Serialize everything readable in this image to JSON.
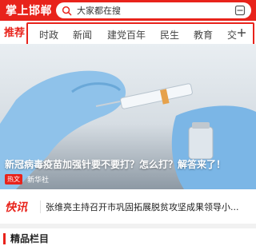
{
  "header": {
    "app_title": "掌上邯郸",
    "search_placeholder": "大家都在搜"
  },
  "tabs": {
    "recommend": "推荐",
    "items": [
      "时政",
      "新闻",
      "建党百年",
      "民生",
      "教育",
      "交"
    ]
  },
  "hero": {
    "caption": "新冠病毒疫苗加强针要不要打？怎么打？解答来了！",
    "tag": "热文",
    "source": "新华社"
  },
  "flash": {
    "logo": "快讯",
    "text": "张维亮主持召开市巩固拓展脱贫攻坚成果领导小..."
  },
  "section": {
    "title": "精品栏目"
  },
  "colors": {
    "brand_red": "#e8231b"
  }
}
